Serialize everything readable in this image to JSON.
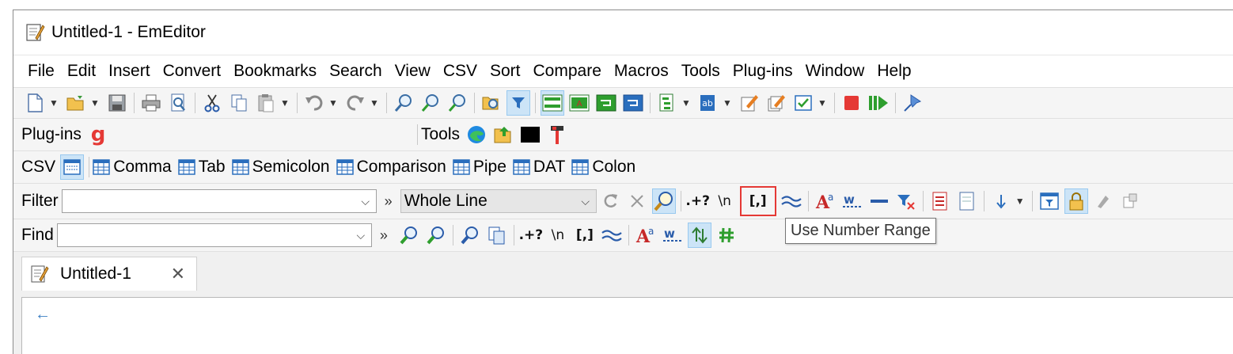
{
  "window": {
    "title": "Untitled-1 - EmEditor"
  },
  "menu": [
    "File",
    "Edit",
    "Insert",
    "Convert",
    "Bookmarks",
    "Search",
    "View",
    "CSV",
    "Sort",
    "Compare",
    "Macros",
    "Tools",
    "Plug-ins",
    "Window",
    "Help"
  ],
  "plugins_bar": {
    "label": "Plug-ins"
  },
  "tools_bar": {
    "label": "Tools"
  },
  "csv_bar": {
    "label": "CSV",
    "formats": [
      "Comma",
      "Tab",
      "Semicolon",
      "Comparison",
      "Pipe",
      "DAT",
      "Colon"
    ]
  },
  "filter_bar": {
    "label": "Filter",
    "value": "",
    "mode": "Whole Line",
    "regex_glyph": ".+?",
    "escape_glyph": "\\n",
    "range_glyph": "[,]",
    "more_glyph": "»"
  },
  "find_bar": {
    "label": "Find",
    "value": "",
    "regex_glyph": ".+?",
    "escape_glyph": "\\n",
    "range_glyph": "[,]",
    "more_glyph": "»"
  },
  "tooltip": {
    "text": "Use Number Range"
  },
  "tabs": [
    {
      "label": "Untitled-1"
    }
  ],
  "colors": {
    "accent": "#cce4f7",
    "highlight_border": "#e53935",
    "stop_red": "#e53935",
    "play_green": "#2e9e2e"
  }
}
